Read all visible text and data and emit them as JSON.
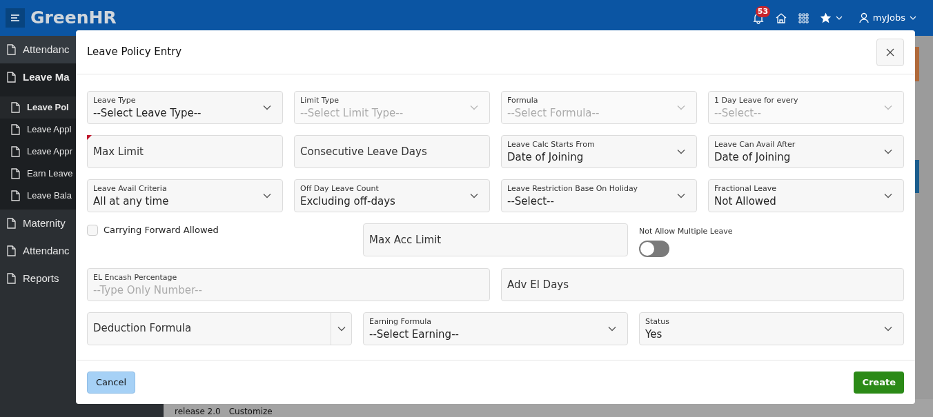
{
  "header": {
    "brand": "GreenHR",
    "notification_count": "53",
    "user": "myJobs"
  },
  "sidebar": {
    "items": [
      {
        "label": "Attendanc",
        "selected": false
      },
      {
        "label": "Leave Ma",
        "selected": true,
        "children": [
          {
            "label": "Leave Pol",
            "selected": true
          },
          {
            "label": "Leave Appl",
            "selected": false
          },
          {
            "label": "Leave Appr",
            "selected": false
          },
          {
            "label": "Earn Leave",
            "selected": false
          },
          {
            "label": "Leave Bala",
            "selected": false
          }
        ]
      },
      {
        "label": "Maternity",
        "selected": false
      },
      {
        "label": "Attendanc",
        "selected": false
      },
      {
        "label": "Reports",
        "selected": false
      }
    ]
  },
  "footer": {
    "version": "release 2.0",
    "link": "Customize"
  },
  "dialog": {
    "title": "Leave Policy Entry",
    "form_rows": [
      {
        "fields": [
          {
            "kind": "select",
            "label": "Leave Type",
            "value": "--Select Leave Type--",
            "disabled": false
          },
          {
            "kind": "select",
            "label": "Limit Type",
            "value": "--Select Limit Type--",
            "disabled": true
          },
          {
            "kind": "select",
            "label": "Formula",
            "value": "--Select Formula--",
            "disabled": true
          },
          {
            "kind": "select",
            "label": "1 Day Leave for every",
            "value": "--Select--",
            "disabled": true
          }
        ]
      },
      {
        "fields": [
          {
            "kind": "text",
            "placeholder": "Max Limit",
            "required": true
          },
          {
            "kind": "text",
            "placeholder": "Consecutive Leave Days",
            "required": false
          },
          {
            "kind": "select",
            "label": "Leave Calc Starts From",
            "value": "Date of Joining",
            "disabled": false
          },
          {
            "kind": "select",
            "label": "Leave Can Avail After",
            "value": "Date of Joining",
            "disabled": false
          }
        ]
      },
      {
        "fields": [
          {
            "kind": "select",
            "label": "Leave Avail Criteria",
            "value": "All at any time",
            "disabled": false
          },
          {
            "kind": "select",
            "label": "Off Day Leave Count",
            "value": "Excluding off-days",
            "disabled": false
          },
          {
            "kind": "select",
            "label": "Leave Restriction Base On Holiday",
            "value": "--Select--",
            "disabled": false
          },
          {
            "kind": "select",
            "label": "Fractional Leave",
            "value": "Not Allowed",
            "disabled": false
          }
        ]
      },
      {
        "fields": [
          {
            "kind": "checkbox",
            "label": "Carrying Forward Allowed",
            "checked": false
          },
          {
            "kind": "text",
            "placeholder": "Max Acc Limit",
            "required": false
          },
          {
            "kind": "switch",
            "label": "Not Allow Multiple Leave",
            "on": false
          }
        ]
      },
      {
        "fields": [
          {
            "kind": "text_labeled",
            "label": "EL Encash Percentage",
            "placeholder": "--Type Only Number--"
          },
          {
            "kind": "text",
            "placeholder": "Adv El Days",
            "required": false
          }
        ]
      },
      {
        "fields": [
          {
            "kind": "combo",
            "placeholder": "Deduction Formula"
          },
          {
            "kind": "select",
            "label": "Earning Formula",
            "value": "--Select Earning--",
            "disabled": false
          },
          {
            "kind": "select",
            "label": "Status",
            "value": "Yes",
            "disabled": false
          }
        ]
      }
    ],
    "buttons": {
      "cancel": "Cancel",
      "create": "Create"
    }
  }
}
